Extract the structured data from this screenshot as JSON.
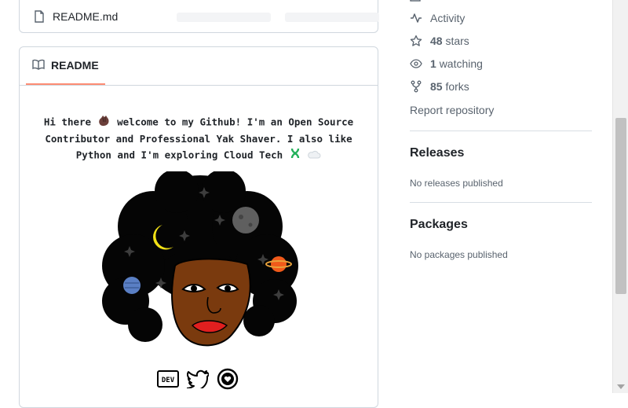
{
  "file_list": {
    "file_name": "README.md"
  },
  "readme": {
    "tab_label": "README",
    "intro_line1": "Hi there",
    "intro_line1b": "welcome to my Github! I'm an Open Source",
    "intro_line2": "Contributor and Professional Yak Shaver. I also like",
    "intro_line3": "Python and I'm exploring Cloud Tech",
    "social_dev": "DEV"
  },
  "sidebar": {
    "activity_label": "Activity",
    "stars_count": "48",
    "stars_label": "stars",
    "watching_count": "1",
    "watching_label": "watching",
    "forks_count": "85",
    "forks_label": "forks",
    "report_label": "Report repository",
    "releases_title": "Releases",
    "releases_note": "No releases published",
    "packages_title": "Packages",
    "packages_note": "No packages published"
  },
  "colors": {
    "tab_underline": "#fd8c73",
    "muted": "#59636e",
    "border": "#d0d7de"
  }
}
